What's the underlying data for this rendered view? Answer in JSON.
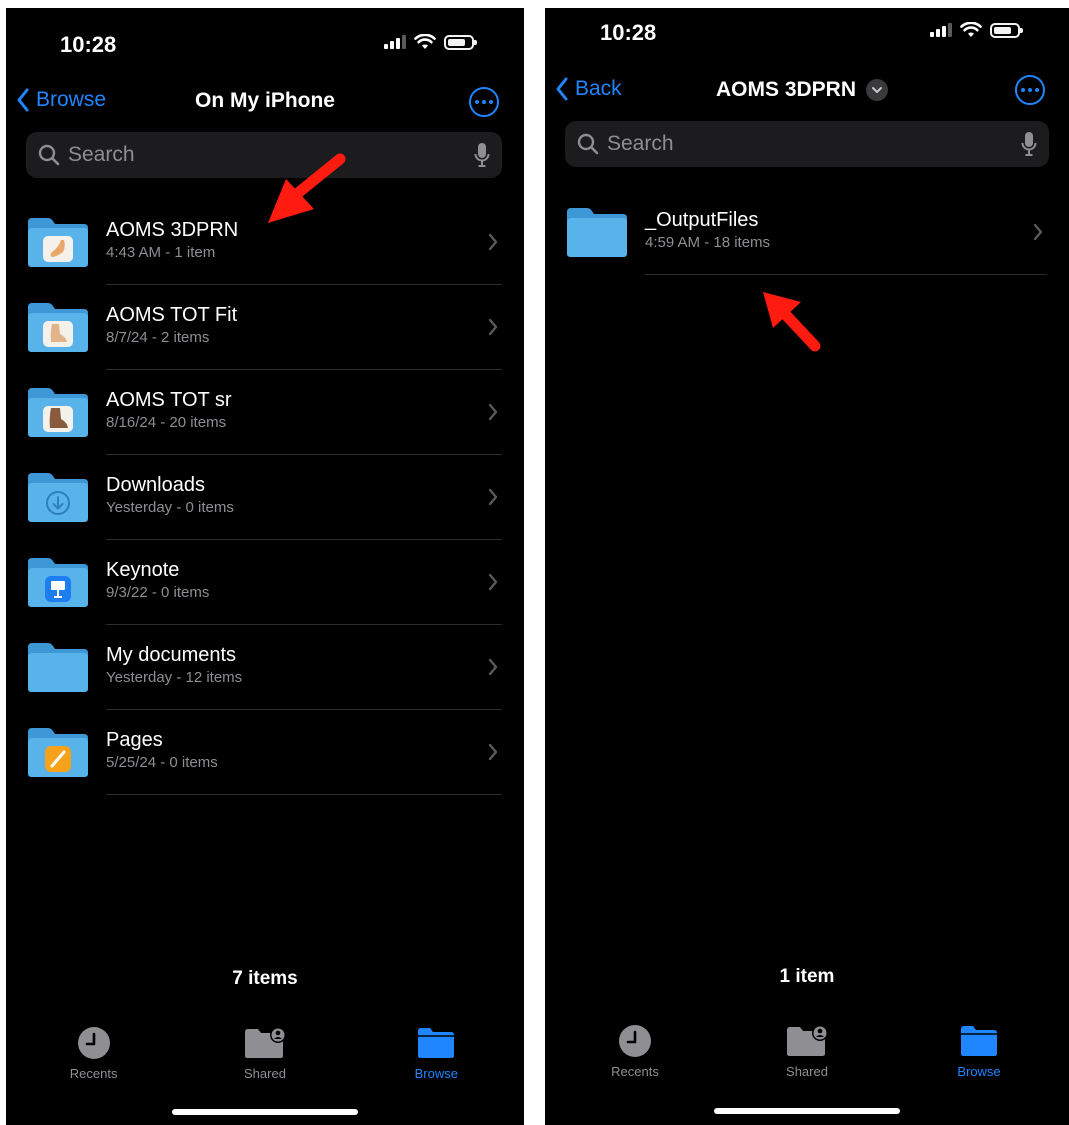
{
  "colors": {
    "accent": "#1f86ff",
    "folder": "#58b3ea",
    "folder_dark": "#3f98d6",
    "annotation_arrow": "#ff1b10"
  },
  "left": {
    "status": {
      "time": "10:28"
    },
    "nav": {
      "back_label": "Browse",
      "title": "On My iPhone"
    },
    "search": {
      "placeholder": "Search"
    },
    "folders": [
      {
        "name": "AOMS 3DPRN",
        "meta": "4:43 AM - 1 item",
        "badge": "app-thumbnail-icon"
      },
      {
        "name": "AOMS TOT Fit",
        "meta": "8/7/24 - 2 items",
        "badge": "app-thumbnail-icon"
      },
      {
        "name": "AOMS TOT sr",
        "meta": "8/16/24 - 20 items",
        "badge": "app-thumbnail-icon"
      },
      {
        "name": "Downloads",
        "meta": "Yesterday - 0 items",
        "badge": "download-icon"
      },
      {
        "name": "Keynote",
        "meta": "9/3/22 - 0 items",
        "badge": "keynote-icon"
      },
      {
        "name": "My documents",
        "meta": "Yesterday - 12 items",
        "badge": "none"
      },
      {
        "name": "Pages",
        "meta": "5/25/24 - 0 items",
        "badge": "pages-icon"
      }
    ],
    "footer": {
      "count": "7 items"
    },
    "tabs": [
      {
        "label": "Recents",
        "icon": "clock-icon",
        "active": false
      },
      {
        "label": "Shared",
        "icon": "shared-folder-icon",
        "active": false
      },
      {
        "label": "Browse",
        "icon": "folder-icon",
        "active": true
      }
    ]
  },
  "right": {
    "status": {
      "time": "10:28"
    },
    "nav": {
      "back_label": "Back",
      "title": "AOMS 3DPRN"
    },
    "search": {
      "placeholder": "Search"
    },
    "folders": [
      {
        "name": "_OutputFiles",
        "meta": "4:59 AM - 18 items",
        "badge": "none"
      }
    ],
    "footer": {
      "count": "1 item"
    },
    "tabs": [
      {
        "label": "Recents",
        "icon": "clock-icon",
        "active": false
      },
      {
        "label": "Shared",
        "icon": "shared-folder-icon",
        "active": false
      },
      {
        "label": "Browse",
        "icon": "folder-icon",
        "active": true
      }
    ]
  }
}
